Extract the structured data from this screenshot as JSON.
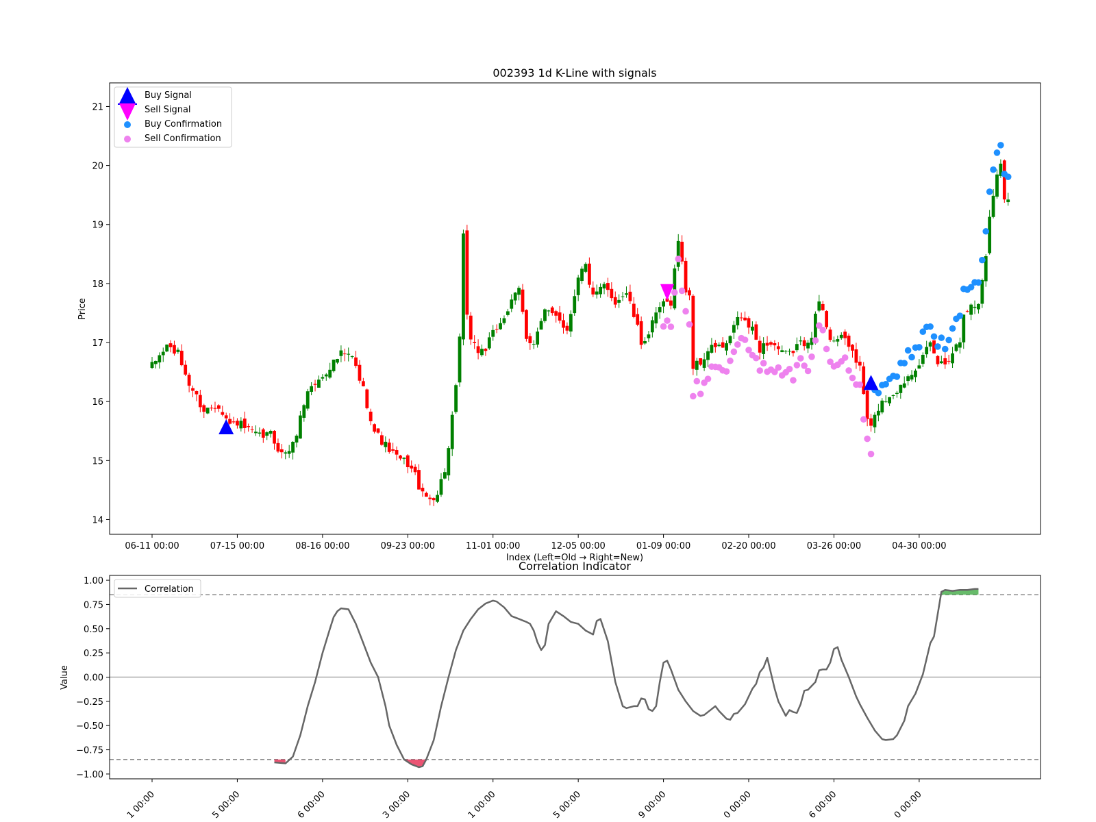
{
  "chart_data": [
    {
      "type": "candlestick",
      "title": "002393 1d K-Line with signals",
      "xlabel": "Index (Left=Old → Right=New)",
      "ylabel": "Price",
      "x_tick_labels": [
        "06-11 00:00",
        "07-15 00:00",
        "08-16 00:00",
        "09-23 00:00",
        "11-01 00:00",
        "12-05 00:00",
        "01-09 00:00",
        "02-20 00:00",
        "03-26 00:00",
        "04-30 00:00"
      ],
      "x_tick_index": [
        0,
        23,
        46,
        69,
        92,
        115,
        138,
        161,
        184,
        207
      ],
      "ylim": [
        13.75,
        21.4
      ],
      "y_ticks": [
        14,
        15,
        16,
        17,
        18,
        19,
        20,
        21
      ],
      "up_color": "#008000",
      "down_color": "#ff0000",
      "legend": {
        "position": "upper-left",
        "entries": [
          {
            "label": "Buy Signal",
            "marker": "triangle-up",
            "color": "#0000ff"
          },
          {
            "label": "Sell Signal",
            "marker": "triangle-down",
            "color": "#ff00ff"
          },
          {
            "label": "Buy Confirmation",
            "marker": "circle",
            "color": "#1e90ff"
          },
          {
            "label": "Sell Confirmation",
            "marker": "circle",
            "color": "#ee82ee"
          }
        ]
      },
      "close_anchors": [
        [
          0,
          16.6
        ],
        [
          4,
          16.95
        ],
        [
          7,
          16.8
        ],
        [
          10,
          16.3
        ],
        [
          14,
          15.85
        ],
        [
          18,
          15.95
        ],
        [
          21,
          15.6
        ],
        [
          23,
          15.65
        ],
        [
          26,
          15.5
        ],
        [
          29,
          15.4
        ],
        [
          32,
          15.45
        ],
        [
          35,
          15.1
        ],
        [
          38,
          15.25
        ],
        [
          42,
          16.2
        ],
        [
          45,
          16.35
        ],
        [
          48,
          16.6
        ],
        [
          51,
          16.8
        ],
        [
          54,
          16.75
        ],
        [
          57,
          16.2
        ],
        [
          60,
          15.5
        ],
        [
          63,
          15.25
        ],
        [
          66,
          15.05
        ],
        [
          69,
          14.95
        ],
        [
          71,
          14.75
        ],
        [
          73,
          14.4
        ],
        [
          75,
          14.35
        ],
        [
          77,
          14.45
        ],
        [
          79,
          14.85
        ],
        [
          80,
          15.2
        ],
        [
          81,
          15.7
        ],
        [
          82,
          16.2
        ],
        [
          83,
          17.1
        ],
        [
          84,
          18.8
        ],
        [
          85,
          17.4
        ],
        [
          86,
          17.1
        ],
        [
          88,
          16.85
        ],
        [
          90,
          16.9
        ],
        [
          93,
          17.25
        ],
        [
          96,
          17.55
        ],
        [
          99,
          17.9
        ],
        [
          101,
          17.1
        ],
        [
          103,
          17.0
        ],
        [
          106,
          17.5
        ],
        [
          109,
          17.5
        ],
        [
          112,
          17.2
        ],
        [
          115,
          18.15
        ],
        [
          117,
          18.3
        ],
        [
          119,
          17.75
        ],
        [
          122,
          17.95
        ],
        [
          125,
          17.7
        ],
        [
          128,
          17.85
        ],
        [
          130,
          17.45
        ],
        [
          132,
          17.0
        ],
        [
          134,
          17.15
        ],
        [
          137,
          17.6
        ],
        [
          140,
          17.7
        ],
        [
          142,
          18.75
        ],
        [
          144,
          17.9
        ],
        [
          145,
          17.8
        ],
        [
          146,
          16.6
        ],
        [
          148,
          16.65
        ],
        [
          150,
          16.85
        ],
        [
          152,
          16.95
        ],
        [
          154,
          16.9
        ],
        [
          156,
          17.05
        ],
        [
          158,
          17.45
        ],
        [
          160,
          17.35
        ],
        [
          162,
          17.2
        ],
        [
          164,
          16.9
        ],
        [
          166,
          17.0
        ],
        [
          168,
          16.95
        ],
        [
          170,
          16.8
        ],
        [
          172,
          16.8
        ],
        [
          174,
          16.95
        ],
        [
          176,
          17.0
        ],
        [
          178,
          17.15
        ],
        [
          180,
          17.7
        ],
        [
          181,
          17.5
        ],
        [
          183,
          17.1
        ],
        [
          185,
          17.05
        ],
        [
          187,
          17.05
        ],
        [
          189,
          16.85
        ],
        [
          191,
          16.55
        ],
        [
          193,
          15.7
        ],
        [
          194,
          15.55
        ],
        [
          196,
          15.9
        ],
        [
          198,
          16.05
        ],
        [
          200,
          16.15
        ],
        [
          202,
          16.25
        ],
        [
          204,
          16.45
        ],
        [
          206,
          16.6
        ],
        [
          208,
          16.75
        ],
        [
          210,
          16.95
        ],
        [
          212,
          16.65
        ],
        [
          214,
          16.65
        ],
        [
          216,
          16.85
        ],
        [
          218,
          17.05
        ],
        [
          219,
          17.55
        ],
        [
          221,
          17.6
        ],
        [
          223,
          17.65
        ],
        [
          225,
          18.5
        ],
        [
          226,
          19.1
        ],
        [
          228,
          19.9
        ],
        [
          229,
          20.05
        ],
        [
          230,
          19.5
        ],
        [
          231,
          19.4
        ]
      ],
      "buy_signals": [
        {
          "index": 20,
          "price": 15.55
        },
        {
          "index": 194,
          "price": 16.3
        }
      ],
      "sell_signals": [
        {
          "index": 139,
          "price": 17.85
        }
      ],
      "buy_confirmation_ranges": [
        [
          195,
          231
        ]
      ],
      "sell_confirmation_ranges": [
        [
          138,
          194
        ]
      ]
    },
    {
      "type": "line",
      "title": "Correlation Indicator",
      "ylabel": "Value",
      "series": [
        {
          "name": "Correlation",
          "color": "#666666"
        }
      ],
      "ylim": [
        -1.05,
        1.05
      ],
      "y_ticks": [
        1.0,
        0.75,
        0.5,
        0.25,
        0.0,
        -0.25,
        -0.5,
        -0.75,
        -1.0
      ],
      "y_tick_labels": [
        "1.00",
        "0.75",
        "0.50",
        "0.25",
        "0.00",
        "−0.25",
        "−0.50",
        "−0.75",
        "−1.00"
      ],
      "x_tick_labels": [
        "1 00:00",
        "5 00:00",
        "6 00:00",
        "3 00:00",
        "1 00:00",
        "5 00:00",
        "9 00:00",
        "0 00:00",
        "6 00:00",
        "0 00:00"
      ],
      "threshold_lines": [
        0.85,
        -0.85
      ],
      "zero_line": 0,
      "legend": {
        "position": "upper-left",
        "entries": [
          {
            "label": "Correlation"
          }
        ]
      },
      "points": [
        [
          33,
          -0.88
        ],
        [
          36,
          -0.89
        ],
        [
          38,
          -0.82
        ],
        [
          40,
          -0.6
        ],
        [
          42,
          -0.3
        ],
        [
          44,
          -0.05
        ],
        [
          46,
          0.25
        ],
        [
          48,
          0.5
        ],
        [
          49,
          0.62
        ],
        [
          50,
          0.68
        ],
        [
          51,
          0.71
        ],
        [
          53,
          0.7
        ],
        [
          55,
          0.55
        ],
        [
          57,
          0.35
        ],
        [
          59,
          0.15
        ],
        [
          61,
          0.0
        ],
        [
          63,
          -0.3
        ],
        [
          64,
          -0.5
        ],
        [
          66,
          -0.7
        ],
        [
          68,
          -0.85
        ],
        [
          70,
          -0.9
        ],
        [
          72,
          -0.93
        ],
        [
          73,
          -0.92
        ],
        [
          74,
          -0.85
        ],
        [
          76,
          -0.65
        ],
        [
          78,
          -0.3
        ],
        [
          80,
          0.0
        ],
        [
          82,
          0.28
        ],
        [
          84,
          0.48
        ],
        [
          86,
          0.6
        ],
        [
          88,
          0.7
        ],
        [
          90,
          0.76
        ],
        [
          92,
          0.79
        ],
        [
          93,
          0.78
        ],
        [
          95,
          0.72
        ],
        [
          97,
          0.63
        ],
        [
          99,
          0.6
        ],
        [
          101,
          0.57
        ],
        [
          102,
          0.55
        ],
        [
          103,
          0.48
        ],
        [
          104,
          0.36
        ],
        [
          105,
          0.28
        ],
        [
          106,
          0.33
        ],
        [
          107,
          0.55
        ],
        [
          109,
          0.68
        ],
        [
          111,
          0.63
        ],
        [
          113,
          0.57
        ],
        [
          115,
          0.55
        ],
        [
          117,
          0.48
        ],
        [
          118,
          0.46
        ],
        [
          119,
          0.44
        ],
        [
          120,
          0.58
        ],
        [
          121,
          0.6
        ],
        [
          123,
          0.37
        ],
        [
          125,
          -0.05
        ],
        [
          127,
          -0.3
        ],
        [
          128,
          -0.32
        ],
        [
          130,
          -0.3
        ],
        [
          131,
          -0.3
        ],
        [
          132,
          -0.22
        ],
        [
          133,
          -0.23
        ],
        [
          134,
          -0.33
        ],
        [
          135,
          -0.35
        ],
        [
          136,
          -0.3
        ],
        [
          137,
          -0.05
        ],
        [
          138,
          0.15
        ],
        [
          139,
          0.17
        ],
        [
          140,
          0.08
        ],
        [
          142,
          -0.13
        ],
        [
          144,
          -0.25
        ],
        [
          146,
          -0.35
        ],
        [
          148,
          -0.4
        ],
        [
          149,
          -0.39
        ],
        [
          151,
          -0.33
        ],
        [
          152,
          -0.3
        ],
        [
          153,
          -0.35
        ],
        [
          155,
          -0.43
        ],
        [
          156,
          -0.44
        ],
        [
          157,
          -0.38
        ],
        [
          158,
          -0.37
        ],
        [
          160,
          -0.28
        ],
        [
          162,
          -0.12
        ],
        [
          163,
          -0.07
        ],
        [
          164,
          0.05
        ],
        [
          165,
          0.1
        ],
        [
          166,
          0.2
        ],
        [
          168,
          -0.12
        ],
        [
          169,
          -0.25
        ],
        [
          171,
          -0.4
        ],
        [
          172,
          -0.34
        ],
        [
          173,
          -0.36
        ],
        [
          174,
          -0.37
        ],
        [
          175,
          -0.28
        ],
        [
          176,
          -0.14
        ],
        [
          177,
          -0.13
        ],
        [
          179,
          -0.05
        ],
        [
          180,
          0.07
        ],
        [
          181,
          0.08
        ],
        [
          182,
          0.08
        ],
        [
          183,
          0.15
        ],
        [
          184,
          0.29
        ],
        [
          185,
          0.31
        ],
        [
          186,
          0.18
        ],
        [
          188,
          0.0
        ],
        [
          190,
          -0.2
        ],
        [
          191,
          -0.28
        ],
        [
          193,
          -0.42
        ],
        [
          195,
          -0.55
        ],
        [
          197,
          -0.64
        ],
        [
          198,
          -0.65
        ],
        [
          200,
          -0.64
        ],
        [
          201,
          -0.6
        ],
        [
          203,
          -0.45
        ],
        [
          204,
          -0.3
        ],
        [
          206,
          -0.17
        ],
        [
          208,
          0.03
        ],
        [
          210,
          0.35
        ],
        [
          211,
          0.42
        ],
        [
          212,
          0.65
        ],
        [
          213,
          0.88
        ],
        [
          214,
          0.9
        ],
        [
          216,
          0.89
        ],
        [
          218,
          0.9
        ],
        [
          220,
          0.9
        ],
        [
          222,
          0.91
        ],
        [
          223,
          0.91
        ]
      ],
      "positive_fill_threshold": 0.85,
      "negative_fill_threshold": -0.85,
      "positive_fill_color": "#4caf50",
      "negative_fill_color": "#e8365b"
    }
  ]
}
